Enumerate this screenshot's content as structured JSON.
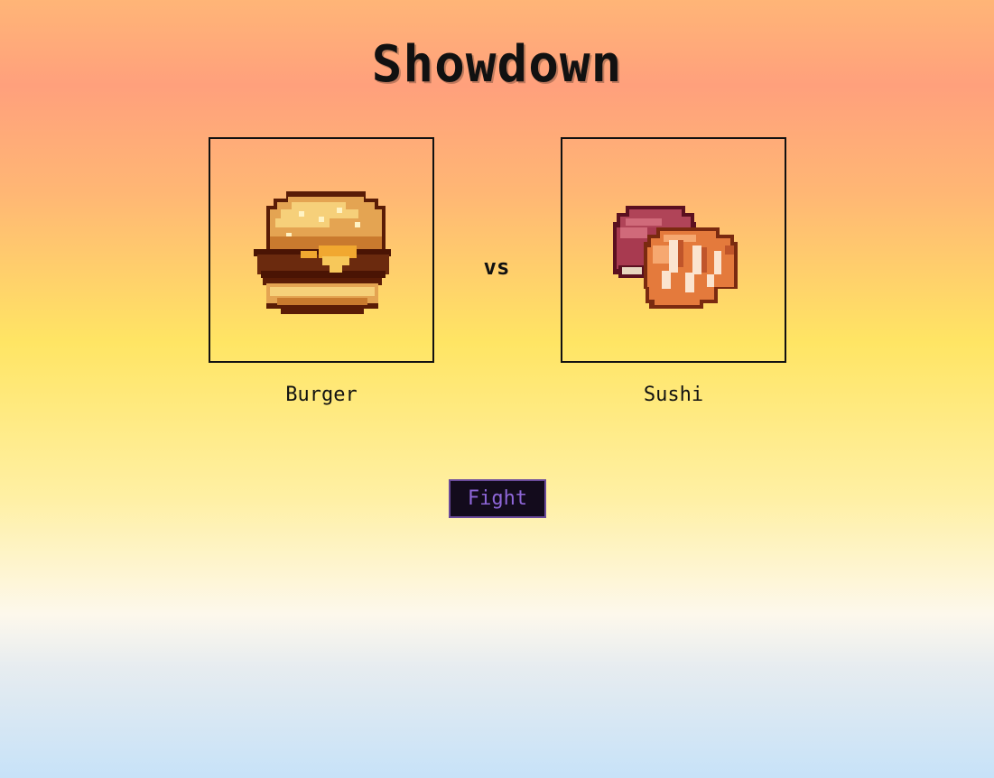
{
  "title": "Showdown",
  "versus": "vs",
  "left": {
    "name": "Burger",
    "icon": "burger-icon"
  },
  "right": {
    "name": "Sushi",
    "icon": "sushi-icon"
  },
  "action": {
    "fight_label": "Fight"
  },
  "colors": {
    "text": "#111111",
    "button_bg": "#130b1c",
    "button_border": "#6a4a9a",
    "button_text": "#8e66d8"
  }
}
